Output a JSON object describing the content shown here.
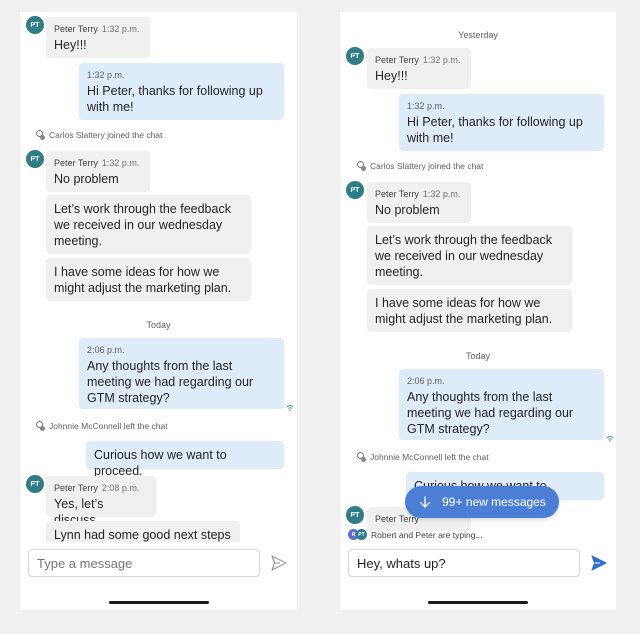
{
  "left": {
    "messages": {
      "m1": {
        "avatar": "PT",
        "sender": "Peter Terry",
        "time": "1:32 p.m.",
        "text": "Hey!!!"
      },
      "m2": {
        "time": "1:32 p.m.",
        "text": "Hi Peter, thanks for following up with me!"
      },
      "sys1": "Carlos Slattery joined the chat",
      "m3": {
        "avatar": "PT",
        "sender": "Peter Terry",
        "time": "1:32 p.m.",
        "text": "No problem"
      },
      "m4": {
        "text": "Let’s work through the feedback we received in our wednesday meeting."
      },
      "m5": {
        "text": "I have some ideas for how we might adjust the marketing plan."
      },
      "date": "Today",
      "m6": {
        "time": "2:06 p.m.",
        "text": "Any thoughts from the last meeting we had regarding our GTM strategy?"
      },
      "sys2": "Johnnie McConnell left the chat",
      "m7": {
        "text": "Curious how we want to proceed."
      },
      "m8": {
        "avatar": "PT",
        "sender": "Peter Terry",
        "time": "2:08 p.m.",
        "text": "Yes, let’s discuss"
      },
      "m9": {
        "text": "Lynn had some good next steps"
      }
    },
    "compose": {
      "placeholder": "Type a message"
    }
  },
  "right": {
    "date_top": "Yesterday",
    "messages": {
      "m1": {
        "avatar": "PT",
        "sender": "Peter Terry",
        "time": "1:32 p.m.",
        "text": "Hey!!!"
      },
      "m2": {
        "time": "1:32 p.m.",
        "text": "Hi Peter, thanks for following up with me!"
      },
      "sys1": "Carlos Slattery joined the chat",
      "m3": {
        "avatar": "PT",
        "sender": "Peter Terry",
        "time": "1:32 p.m.",
        "text": "No problem"
      },
      "m4": {
        "text": "Let’s work through the feedback we received in our wednesday meeting."
      },
      "m5": {
        "text": "I have some ideas for how we might adjust the marketing plan."
      },
      "date": "Today",
      "m6": {
        "time": "2:06 p.m.",
        "text": "Any thoughts from the last meeting we had regarding our GTM strategy?"
      },
      "sys2": "Johnnie McConnell left the chat",
      "m7": {
        "text": "Curious how we want to proceed."
      },
      "m8": {
        "avatar": "PT",
        "sender": "Peter Terry"
      }
    },
    "new_messages": "99+ new messages",
    "typing": {
      "avatars": [
        "R",
        "PT"
      ],
      "text": "Robert and Peter are typing..."
    },
    "compose": {
      "value": "Hey, whats up?"
    }
  },
  "colors": {
    "avatar": "#2e7d87",
    "outgoing_bubble": "#deebf8",
    "incoming_bubble": "#f0f0f0",
    "accent": "#4b7fd6",
    "send_active": "#2f6fd1",
    "send_inactive": "#9a9a9a"
  },
  "icons": {
    "send": "send-icon",
    "seen": "seen-icon",
    "system_event": "people-icon",
    "arrow_down": "arrow-down-icon"
  }
}
